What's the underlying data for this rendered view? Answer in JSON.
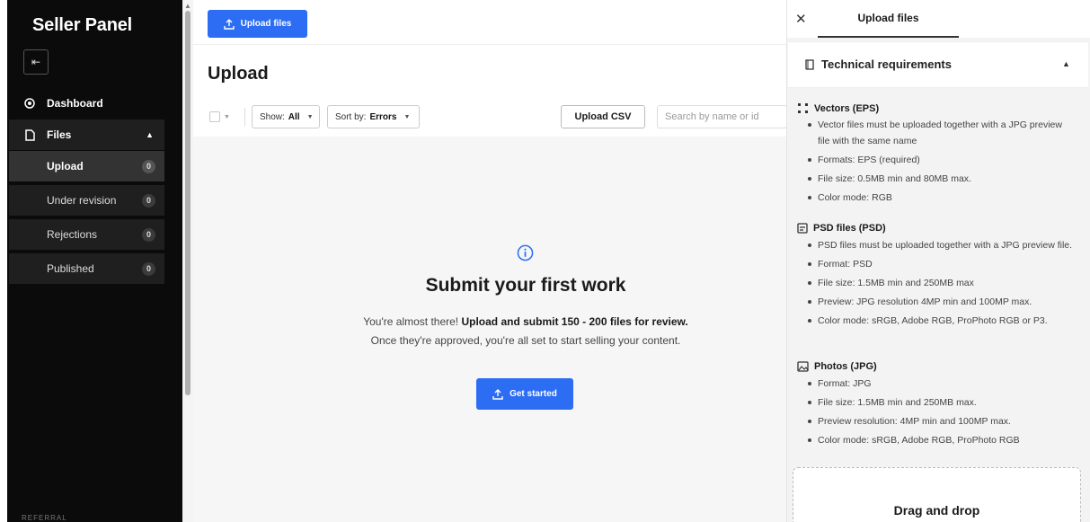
{
  "sidebar": {
    "title": "Seller Panel",
    "collapse_icon": "collapse-left-icon",
    "dashboard": "Dashboard",
    "files": "Files",
    "sub": [
      {
        "label": "Upload",
        "count": "0"
      },
      {
        "label": "Under revision",
        "count": "0"
      },
      {
        "label": "Rejections",
        "count": "0"
      },
      {
        "label": "Published",
        "count": "0"
      }
    ],
    "footer": "REFERRAL"
  },
  "header": {
    "upload_files": "Upload files"
  },
  "main": {
    "title": "Upload",
    "show_label": "Show:",
    "show_value": "All",
    "sort_label": "Sort by:",
    "sort_value": "Errors",
    "upload_csv": "Upload CSV",
    "search_placeholder": "Search by name or id",
    "empty_title": "Submit your first work",
    "empty_text_1": "You're almost there! ",
    "empty_text_bold": "Upload and submit 150 - 200 files for review.",
    "empty_text_2": " Once they're approved, you're all set to start selling your content.",
    "get_started": "Get started"
  },
  "panel": {
    "tab": "Upload files",
    "req_title": "Technical requirements",
    "vectors_title": "Vectors (EPS)",
    "vectors": [
      "Vector files must be uploaded together with a JPG preview file with the same name",
      "Formats: EPS (required)",
      "File size: 0.5MB min and 80MB max.",
      "Color mode: RGB"
    ],
    "psd_title": "PSD files (PSD)",
    "psd": [
      "PSD files must be uploaded together with a JPG preview file.",
      "Format: PSD",
      "File size: 1.5MB min and 250MB max",
      "Preview: JPG resolution 4MP min and 100MP max.",
      "Color mode: sRGB, Adobe RGB, ProPhoto RGB or P3."
    ],
    "photos_title": "Photos (JPG)",
    "photos": [
      "Format: JPG",
      "File size: 1.5MB min and 250MB max.",
      "Preview resolution: 4MP min and 100MP max.",
      "Color mode: sRGB, Adobe RGB, ProPhoto RGB"
    ],
    "drag_drop": "Drag and drop"
  },
  "colors": {
    "primary": "#2c6df4",
    "sidebar_bg": "#0b0b0b"
  }
}
